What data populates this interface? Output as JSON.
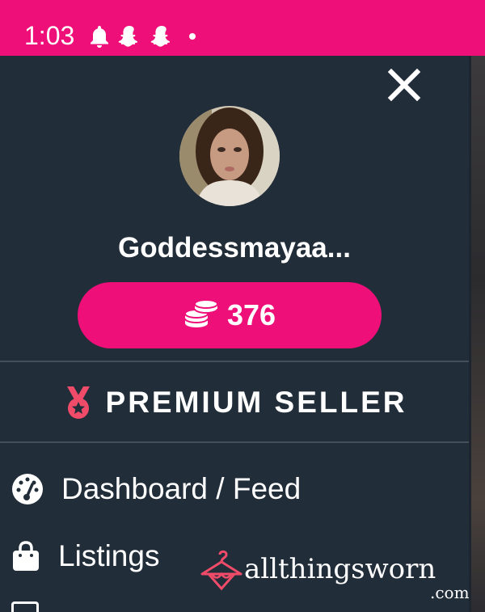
{
  "status_bar": {
    "time": "1:03",
    "icons": [
      "notification-bell-icon",
      "snapchat-icon",
      "snapchat-icon",
      "dot-icon"
    ],
    "color": "#ee0f78"
  },
  "drawer": {
    "username": "Goddessmayaa...",
    "coins": {
      "count": "376",
      "icon": "coin-stack-icon",
      "color": "#ee0f78"
    },
    "badge": {
      "label": "PREMIUM SELLER",
      "icon": "medal-icon",
      "color": "#f04c6a"
    },
    "menu": [
      {
        "label": "Dashboard / Feed",
        "icon": "dashboard-gauge-icon"
      },
      {
        "label": "Listings",
        "icon": "shopping-bag-icon"
      }
    ],
    "background": "#222d3a"
  },
  "brand": {
    "name": "allthingsworn",
    "tld": ".com",
    "icon": "hanger-icon",
    "accent": "#f04c6a"
  }
}
